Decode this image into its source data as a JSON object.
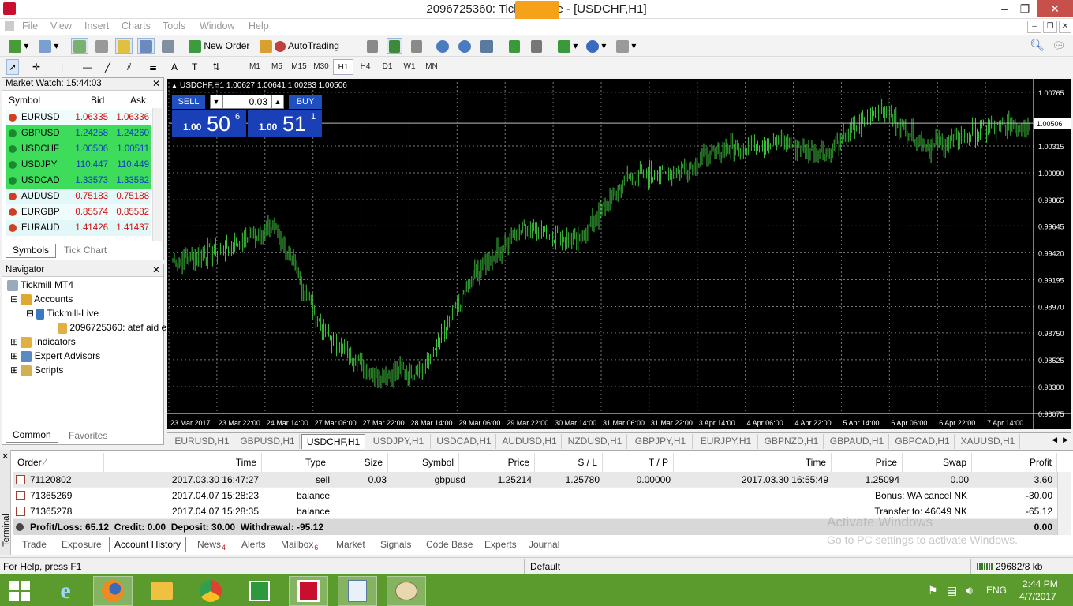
{
  "window": {
    "title": "2096725360: Tickmill-Live - [USDCHF,H1]"
  },
  "menu": [
    "File",
    "View",
    "Insert",
    "Charts",
    "Tools",
    "Window",
    "Help"
  ],
  "toolbar": {
    "new_order": "New Order",
    "autotrading": "AutoTrading",
    "timeframes": [
      "M1",
      "M5",
      "M15",
      "M30",
      "H1",
      "H4",
      "D1",
      "W1",
      "MN"
    ],
    "selected_timeframe": "H1"
  },
  "market_watch": {
    "title": "Market Watch: 15:44:03",
    "col_symbol": "Symbol",
    "col_bid": "Bid",
    "col_ask": "Ask",
    "rows": [
      {
        "symbol": "EURUSD",
        "bid": "1.06335",
        "ask": "1.06336",
        "dir": "down"
      },
      {
        "symbol": "GBPUSD",
        "bid": "1.24258",
        "ask": "1.24260",
        "dir": "up"
      },
      {
        "symbol": "USDCHF",
        "bid": "1.00506",
        "ask": "1.00511",
        "dir": "up"
      },
      {
        "symbol": "USDJPY",
        "bid": "110.447",
        "ask": "110.449",
        "dir": "up"
      },
      {
        "symbol": "USDCAD",
        "bid": "1.33573",
        "ask": "1.33582",
        "dir": "up"
      },
      {
        "symbol": "AUDUSD",
        "bid": "0.75183",
        "ask": "0.75188",
        "dir": "down"
      },
      {
        "symbol": "EURGBP",
        "bid": "0.85574",
        "ask": "0.85582",
        "dir": "down"
      },
      {
        "symbol": "EURAUD",
        "bid": "1.41426",
        "ask": "1.41437",
        "dir": "down"
      }
    ],
    "tab_symbols": "Symbols",
    "tab_tick": "Tick Chart"
  },
  "navigator": {
    "title": "Navigator",
    "root": "Tickmill MT4",
    "accounts": "Accounts",
    "server": "Tickmill-Live",
    "account": "2096725360: atef aid e",
    "indicators": "Indicators",
    "experts": "Expert Advisors",
    "scripts": "Scripts",
    "tab_common": "Common",
    "tab_favorites": "Favorites"
  },
  "chart": {
    "header": "USDCHF,H1  1.00627 1.00641 1.00283 1.00506",
    "sell_label": "SELL",
    "buy_label": "BUY",
    "lot": "0.03",
    "sell_lots": "1.00",
    "sell_big": "50",
    "sell_sup": "6",
    "buy_lots": "1.00",
    "buy_big": "51",
    "buy_sup": "1",
    "current_price": "1.00506",
    "price_ticks": [
      "1.00765",
      "1.00315",
      "1.00090",
      "0.99865",
      "0.99645",
      "0.99420",
      "0.99195",
      "0.98970",
      "0.98750",
      "0.98525",
      "0.98300",
      "0.98075"
    ],
    "time_ticks": [
      "23 Mar 2017",
      "23 Mar 22:00",
      "24 Mar 14:00",
      "27 Mar 06:00",
      "27 Mar 22:00",
      "28 Mar 14:00",
      "29 Mar 06:00",
      "29 Mar 22:00",
      "30 Mar 14:00",
      "31 Mar 06:00",
      "31 Mar 22:00",
      "3 Apr 14:00",
      "4 Apr 06:00",
      "4 Apr 22:00",
      "5 Apr 14:00",
      "6 Apr 06:00",
      "6 Apr 22:00",
      "7 Apr 14:00"
    ],
    "color_up": "#3ec43e"
  },
  "chart_data": {
    "type": "line",
    "title": "USDCHF,H1",
    "xlabel": "",
    "ylabel": "",
    "ylim": [
      0.98075,
      1.0085
    ],
    "x": [
      "23 Mar 2017",
      "23 Mar 22:00",
      "24 Mar 14:00",
      "27 Mar 06:00",
      "27 Mar 22:00",
      "28 Mar 14:00",
      "29 Mar 06:00",
      "29 Mar 22:00",
      "30 Mar 14:00",
      "31 Mar 06:00",
      "31 Mar 22:00",
      "3 Apr 14:00",
      "4 Apr 06:00",
      "4 Apr 22:00",
      "5 Apr 14:00",
      "6 Apr 06:00",
      "6 Apr 22:00",
      "7 Apr 14:00"
    ],
    "series": [
      {
        "values": [
          0.9935,
          0.9945,
          0.9965,
          0.9875,
          0.984,
          0.9845,
          0.9925,
          0.9965,
          0.995,
          1.0005,
          1.001,
          1.003,
          1.0035,
          1.0025,
          1.0065,
          1.003,
          1.0045,
          1.00506
        ]
      }
    ]
  },
  "chart_tabs": [
    "EURUSD,H1",
    "GBPUSD,H1",
    "USDCHF,H1",
    "USDJPY,H1",
    "USDCAD,H1",
    "AUDUSD,H1",
    "NZDUSD,H1",
    "GBPJPY,H1",
    "EURJPY,H1",
    "GBPNZD,H1",
    "GBPAUD,H1",
    "GBPCAD,H1",
    "XAUUSD,H1"
  ],
  "terminal": {
    "label": "Terminal",
    "headers": [
      "Order",
      "Time",
      "Type",
      "Size",
      "Symbol",
      "Price",
      "S / L",
      "T / P",
      "Time",
      "Price",
      "Swap",
      "Profit"
    ],
    "rows": [
      {
        "order": "71120802",
        "time": "2017.03.30 16:47:27",
        "type": "sell",
        "size": "0.03",
        "symbol": "gbpusd",
        "price": "1.25214",
        "sl": "1.25780",
        "tp": "0.00000",
        "ctime": "2017.03.30 16:55:49",
        "cprice": "1.25094",
        "swap": "0.00",
        "profit": "3.60"
      },
      {
        "order": "71365269",
        "time": "2017.04.07 15:28:23",
        "type": "balance",
        "comment": "Bonus: WA cancel NK",
        "profit": "-30.00"
      },
      {
        "order": "71365278",
        "time": "2017.04.07 15:28:35",
        "type": "balance",
        "comment": "Transfer to: 46049 NK",
        "profit": "-65.12"
      }
    ],
    "summary": "Profit/Loss: 65.12  Credit: 0.00  Deposit: 30.00  Withdrawal: -95.12",
    "summary_total": "0.00",
    "tabs": [
      "Trade",
      "Exposure",
      "Account History",
      "News",
      "Alerts",
      "Mailbox",
      "Market",
      "Signals",
      "Code Base",
      "Experts",
      "Journal"
    ],
    "news_count": "4",
    "mailbox_count": "6"
  },
  "watermark": {
    "line1": "Activate Windows",
    "line2": "Go to PC settings to activate Windows."
  },
  "status": {
    "help": "For Help, press F1",
    "profile": "Default",
    "traffic": "29682/8 kb"
  },
  "taskbar": {
    "lang": "ENG",
    "time": "2:44 PM",
    "date": "4/7/2017"
  }
}
